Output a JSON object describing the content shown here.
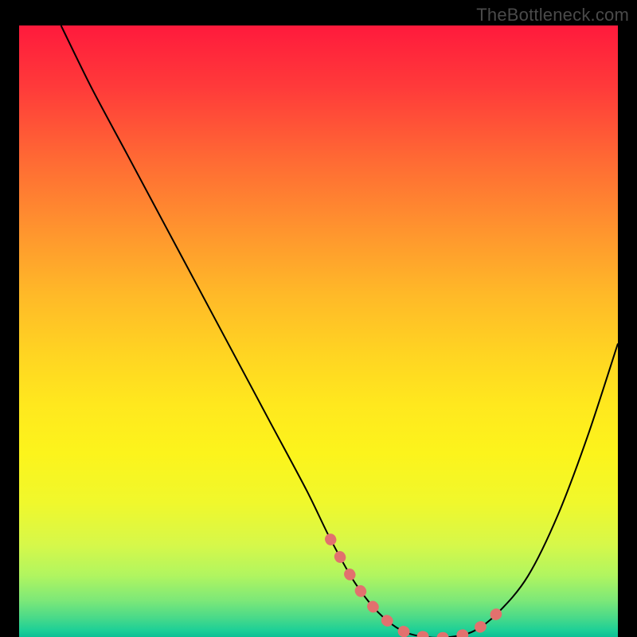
{
  "watermark": "TheBottleneck.com",
  "chart_data": {
    "type": "line",
    "title": "",
    "xlabel": "",
    "ylabel": "",
    "xlim": [
      0,
      100
    ],
    "ylim": [
      0,
      100
    ],
    "grid": false,
    "series": [
      {
        "name": "curve",
        "x": [
          7,
          12,
          18,
          24,
          30,
          36,
          42,
          48,
          52,
          56,
          60,
          64,
          68,
          72,
          76,
          80,
          85,
          90,
          95,
          100
        ],
        "y": [
          100,
          90,
          79,
          68,
          57,
          46,
          35,
          24,
          16,
          9,
          4,
          1,
          0,
          0,
          1,
          4,
          10,
          20,
          33,
          48
        ]
      },
      {
        "name": "markers",
        "x": [
          52,
          56,
          60,
          64,
          68,
          72,
          76,
          80
        ],
        "y": [
          16,
          9,
          4,
          1,
          0,
          0,
          1,
          4
        ]
      }
    ],
    "colors": {
      "curve": "#000000",
      "markers": "#e2716e",
      "gradient_top": "#ff1a3c",
      "gradient_bottom": "#0cbf95"
    }
  }
}
